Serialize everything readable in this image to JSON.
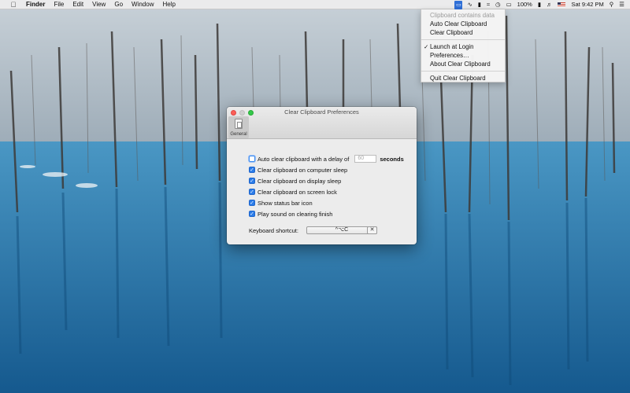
{
  "menubar": {
    "apple_icon": "apple-icon",
    "app_name": "Finder",
    "menus": [
      "File",
      "Edit",
      "View",
      "Go",
      "Window",
      "Help"
    ],
    "status": {
      "battery_percent": "100%",
      "clock": "Sat 9:42 PM",
      "icons": [
        "clear-clipboard-icon",
        "sync-icon",
        "battery-bar-icon",
        "wifi-icon",
        "time-machine-icon",
        "airplay-icon",
        "battery-icon",
        "volume-icon",
        "flag-icon",
        "search-icon",
        "list-icon"
      ]
    }
  },
  "dropdown": {
    "status_text": "Clipboard contains data",
    "items_group1": [
      "Auto Clear Clipboard",
      "Clear Clipboard"
    ],
    "check_mark": "✓",
    "items_group2": [
      "Launch at Login",
      "Preferences…",
      "About Clear Clipboard"
    ],
    "quit": "Quit Clear Clipboard"
  },
  "window": {
    "title": "Clear Clipboard Preferences",
    "tab_general": "General",
    "auto_clear": {
      "label": "Auto clear clipboard with a delay of",
      "checked": false,
      "value": "60",
      "unit": "seconds"
    },
    "options": [
      {
        "label": "Clear clipboard on computer sleep",
        "checked": true
      },
      {
        "label": "Clear clipboard on display sleep",
        "checked": true
      },
      {
        "label": "Clear clipboard on screen lock",
        "checked": true
      },
      {
        "label": "Show status bar icon",
        "checked": true
      },
      {
        "label": "Play sound on clearing finish",
        "checked": true
      }
    ],
    "checkmark_glyph": "✓",
    "shortcut": {
      "label": "Keyboard shortcut:",
      "value": "^⌥C",
      "clear": "✕"
    }
  }
}
